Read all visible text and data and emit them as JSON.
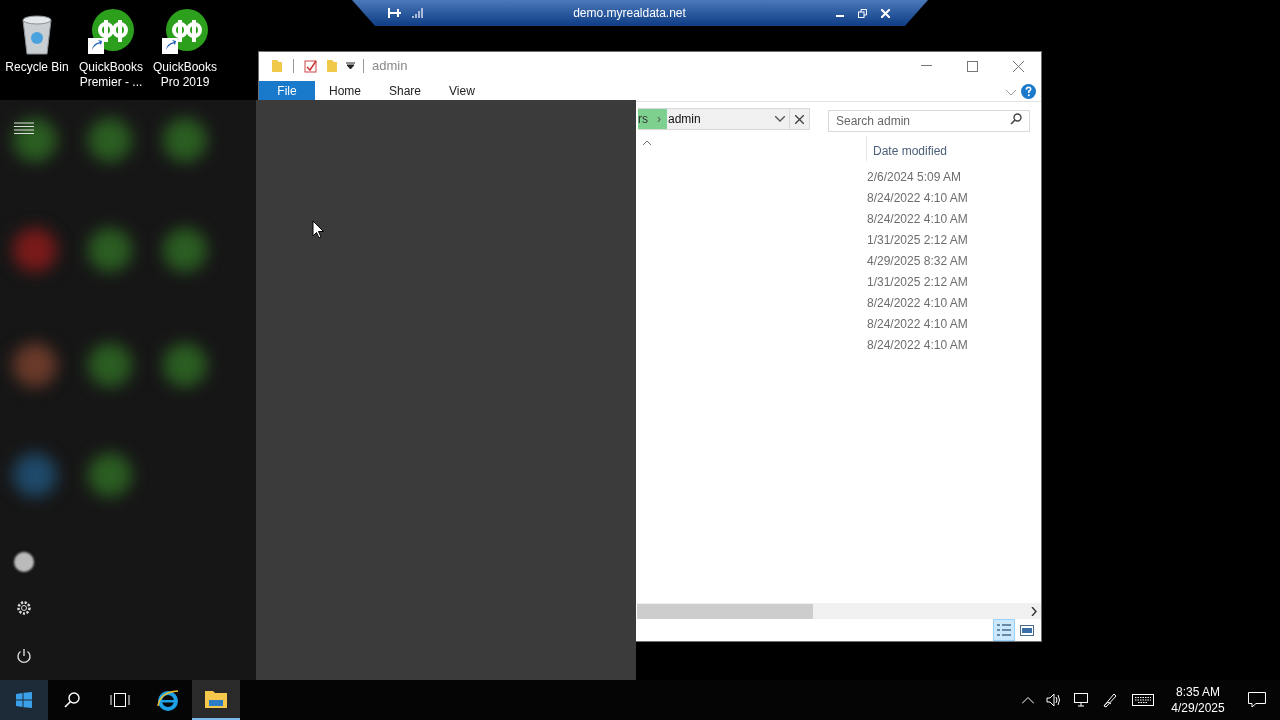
{
  "remote_bar": {
    "title": "demo.myrealdata.net"
  },
  "desktop_icons": [
    {
      "label": "Recycle Bin",
      "kind": "recycle"
    },
    {
      "label": "QuickBooks Premier - ...",
      "kind": "quickbooks"
    },
    {
      "label": "QuickBooks Pro 2019",
      "kind": "quickbooks"
    }
  ],
  "explorer": {
    "title": "admin",
    "ribbon_tabs": [
      {
        "label": "File",
        "selected": true
      },
      {
        "label": "Home",
        "selected": false
      },
      {
        "label": "Share",
        "selected": false
      },
      {
        "label": "View",
        "selected": false
      }
    ],
    "address": {
      "crumb": "rs",
      "separator": "›",
      "current": "admin"
    },
    "search": {
      "placeholder": "Search admin"
    },
    "column": "Date modified",
    "rows": [
      {
        "date_modified": "2/6/2024 5:09 AM"
      },
      {
        "date_modified": "8/24/2022 4:10 AM"
      },
      {
        "date_modified": "8/24/2022 4:10 AM"
      },
      {
        "date_modified": "1/31/2025 2:12 AM"
      },
      {
        "date_modified": "4/29/2025 8:32 AM"
      },
      {
        "date_modified": "1/31/2025 2:12 AM"
      },
      {
        "date_modified": "8/24/2022 4:10 AM"
      },
      {
        "date_modified": "8/24/2022 4:10 AM"
      },
      {
        "date_modified": "8/24/2022 4:10 AM"
      }
    ]
  },
  "taskbar": {
    "apps": [
      {
        "kind": "browser",
        "active": false
      },
      {
        "kind": "explorer",
        "active": true
      }
    ],
    "time": "8:35 AM",
    "date": "4/29/2025"
  }
}
